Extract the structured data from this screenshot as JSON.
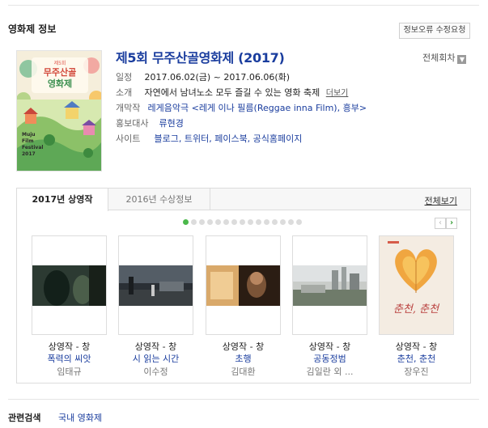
{
  "section_title": "영화제 정보",
  "report_button": "정보오류 수정요청",
  "festival": {
    "title": "제5회 무주산골영화제 (2017)",
    "all_episodes_label": "전체회차",
    "date": {
      "label": "일정",
      "value": "2017.06.02(금) ~ 2017.06.06(화)"
    },
    "intro": {
      "label": "소개",
      "value": "자연에서 남녀노소 모두 즐길 수 있는 영화 축제",
      "more": "더보기"
    },
    "opening": {
      "label": "개막작",
      "value": "레게음악극 <레게 이나 필름(Reggae inna Film), 흥부>"
    },
    "ambassador": {
      "label": "홍보대사",
      "value": "류현경"
    },
    "site": {
      "label": "사이트",
      "value": "블로그, 트위터, 페이스북, 공식홈페이지"
    }
  },
  "poster_text": {
    "line1": "제5회",
    "line2": "무주산골",
    "line3": "영화제",
    "line4": "Muju",
    "line5": "Film",
    "line6": "Festival",
    "line7": "2017"
  },
  "tabs": {
    "active": "2017년 상영작",
    "inactive": "2016년 수상정보",
    "see_all": "전체보기"
  },
  "carousel": {
    "prev": "‹",
    "next": "›",
    "dots_total": 15,
    "current": 1
  },
  "films": [
    {
      "category": "상영작 - 창",
      "title": "폭력의 씨앗",
      "director": "임태규"
    },
    {
      "category": "상영작 - 창",
      "title": "시 읽는 시간",
      "director": "이수정"
    },
    {
      "category": "상영작 - 창",
      "title": "초행",
      "director": "김대환"
    },
    {
      "category": "상영작 - 창",
      "title": "공동정범",
      "director": "김일란 외 ..."
    },
    {
      "category": "상영작 - 창",
      "title": "춘천, 춘천",
      "director": "장우진",
      "poster_text": "춘천, 춘천"
    }
  ],
  "related": {
    "label": "관련검색",
    "link": "국내 영화제"
  }
}
